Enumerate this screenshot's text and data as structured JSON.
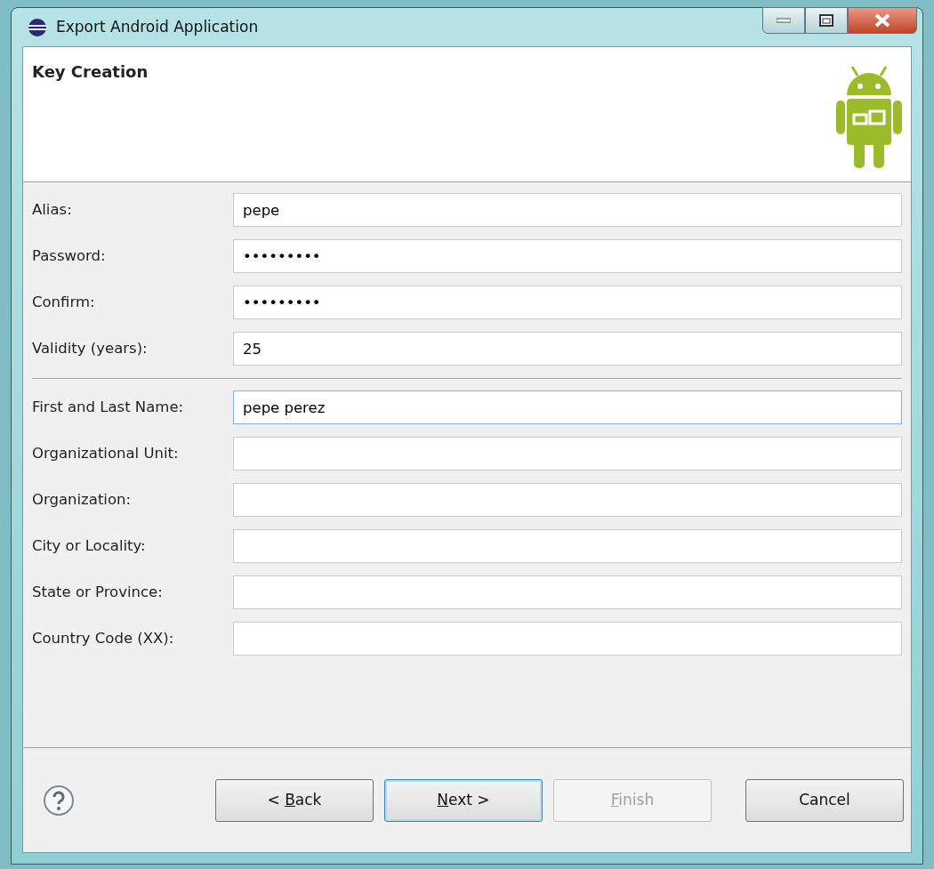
{
  "window": {
    "title": "Export Android Application"
  },
  "banner": {
    "title": "Key Creation"
  },
  "field_groups": [
    {
      "fields": [
        {
          "label": "Alias:",
          "value": "pepe",
          "focused": false
        },
        {
          "label": "Password:",
          "value": "•••••••••",
          "focused": false
        },
        {
          "label": "Confirm:",
          "value": "•••••••••",
          "focused": false
        },
        {
          "label": "Validity (years):",
          "value": "25",
          "focused": false
        }
      ]
    },
    {
      "fields": [
        {
          "label": "First and Last Name:",
          "value": "pepe perez",
          "focused": true
        },
        {
          "label": "Organizational Unit:",
          "focused": false
        },
        {
          "label": "Organization:",
          "focused": false
        },
        {
          "label": "City or Locality:",
          "focused": false
        },
        {
          "label": "State or Province:",
          "focused": false
        },
        {
          "label": "Country Code (XX):",
          "focused": false
        }
      ]
    }
  ],
  "buttons": [
    {
      "before": "< ",
      "mnemonic": "B",
      "after": "ack",
      "default": false,
      "disabled": false
    },
    {
      "mnemonic": "N",
      "after": "ext >",
      "default": true,
      "disabled": false
    },
    {
      "mnemonic": "F",
      "after": "inish",
      "default": false,
      "disabled": true
    },
    {
      "before": "Cancel",
      "default": false,
      "disabled": false
    }
  ]
}
